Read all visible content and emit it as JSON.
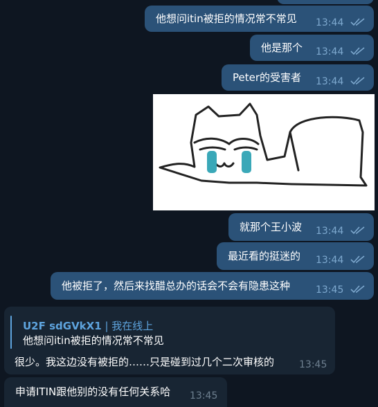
{
  "messages": [
    {
      "text": "他想问itin被拒的情况常不常见",
      "time": "13:44"
    },
    {
      "text": "他是那个",
      "time": "13:44"
    },
    {
      "text": "Peter的受害者",
      "time": "13:44"
    },
    {
      "text": "就那个王小波",
      "time": "13:44"
    },
    {
      "text": "最近看的挺迷的",
      "time": "13:44"
    },
    {
      "text": "他被拒了，然后来找醋总办的话会不会有隐患这种",
      "time": "13:45"
    }
  ],
  "reply": {
    "name": "U2F sdGVkX1",
    "separator": "|",
    "status": "我在线上",
    "quoted": "他想问itin被拒的情况常不常见",
    "text": "很少。我这边没有被拒的……只是碰到过几个二次审核的",
    "time": "13:45"
  },
  "last_message": {
    "text": "申请ITIN跟他别的没有任何关系哈",
    "time": "13:45"
  },
  "icons": {
    "read": "double-check-icon",
    "sticker": "crying-cat-sticker"
  },
  "colors": {
    "background": "#0e1621",
    "outgoing": "#2b5278",
    "incoming": "#182533",
    "accent": "#5ea4de"
  }
}
